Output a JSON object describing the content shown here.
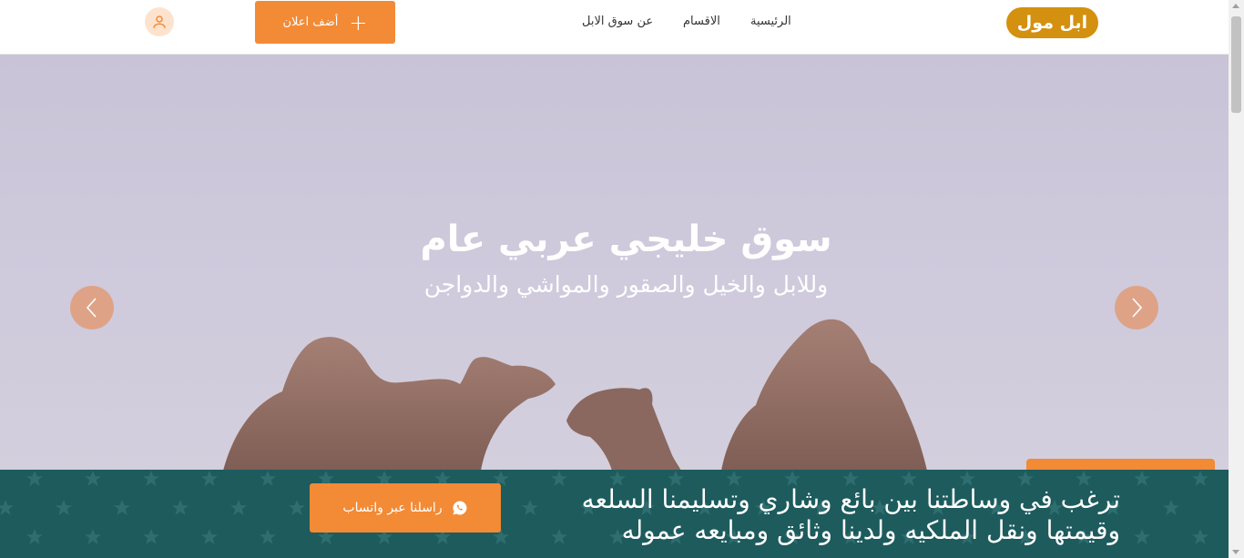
{
  "header": {
    "logo": "ابل مول",
    "nav": [
      "الرئيسية",
      "الاقسام",
      "عن سوق الابل"
    ],
    "add_ad": "أضف اعلان",
    "icons": {
      "add": "plus-icon",
      "user": "user-icon"
    },
    "brand_color": "#d4900f",
    "accent_color": "#f38a35"
  },
  "hero": {
    "title": "سوق خليجي عربي عام",
    "subtitle": "وللابل والخيل والصقور والمواشي والدواجن",
    "icons": {
      "prev": "chevron-left-icon",
      "next": "chevron-right-icon"
    }
  },
  "banner": {
    "line1": "ترغب في وساطتنا بين بائع وشاري وتسليمنا السلعه",
    "line2": "وقيمتها ونقل الملكيه ولدينا وثائق ومبايعه عموله",
    "whatsapp": "راسلنا عبر واتساب",
    "icon": "whatsapp-icon",
    "bg_color": "#1d5b5d"
  }
}
